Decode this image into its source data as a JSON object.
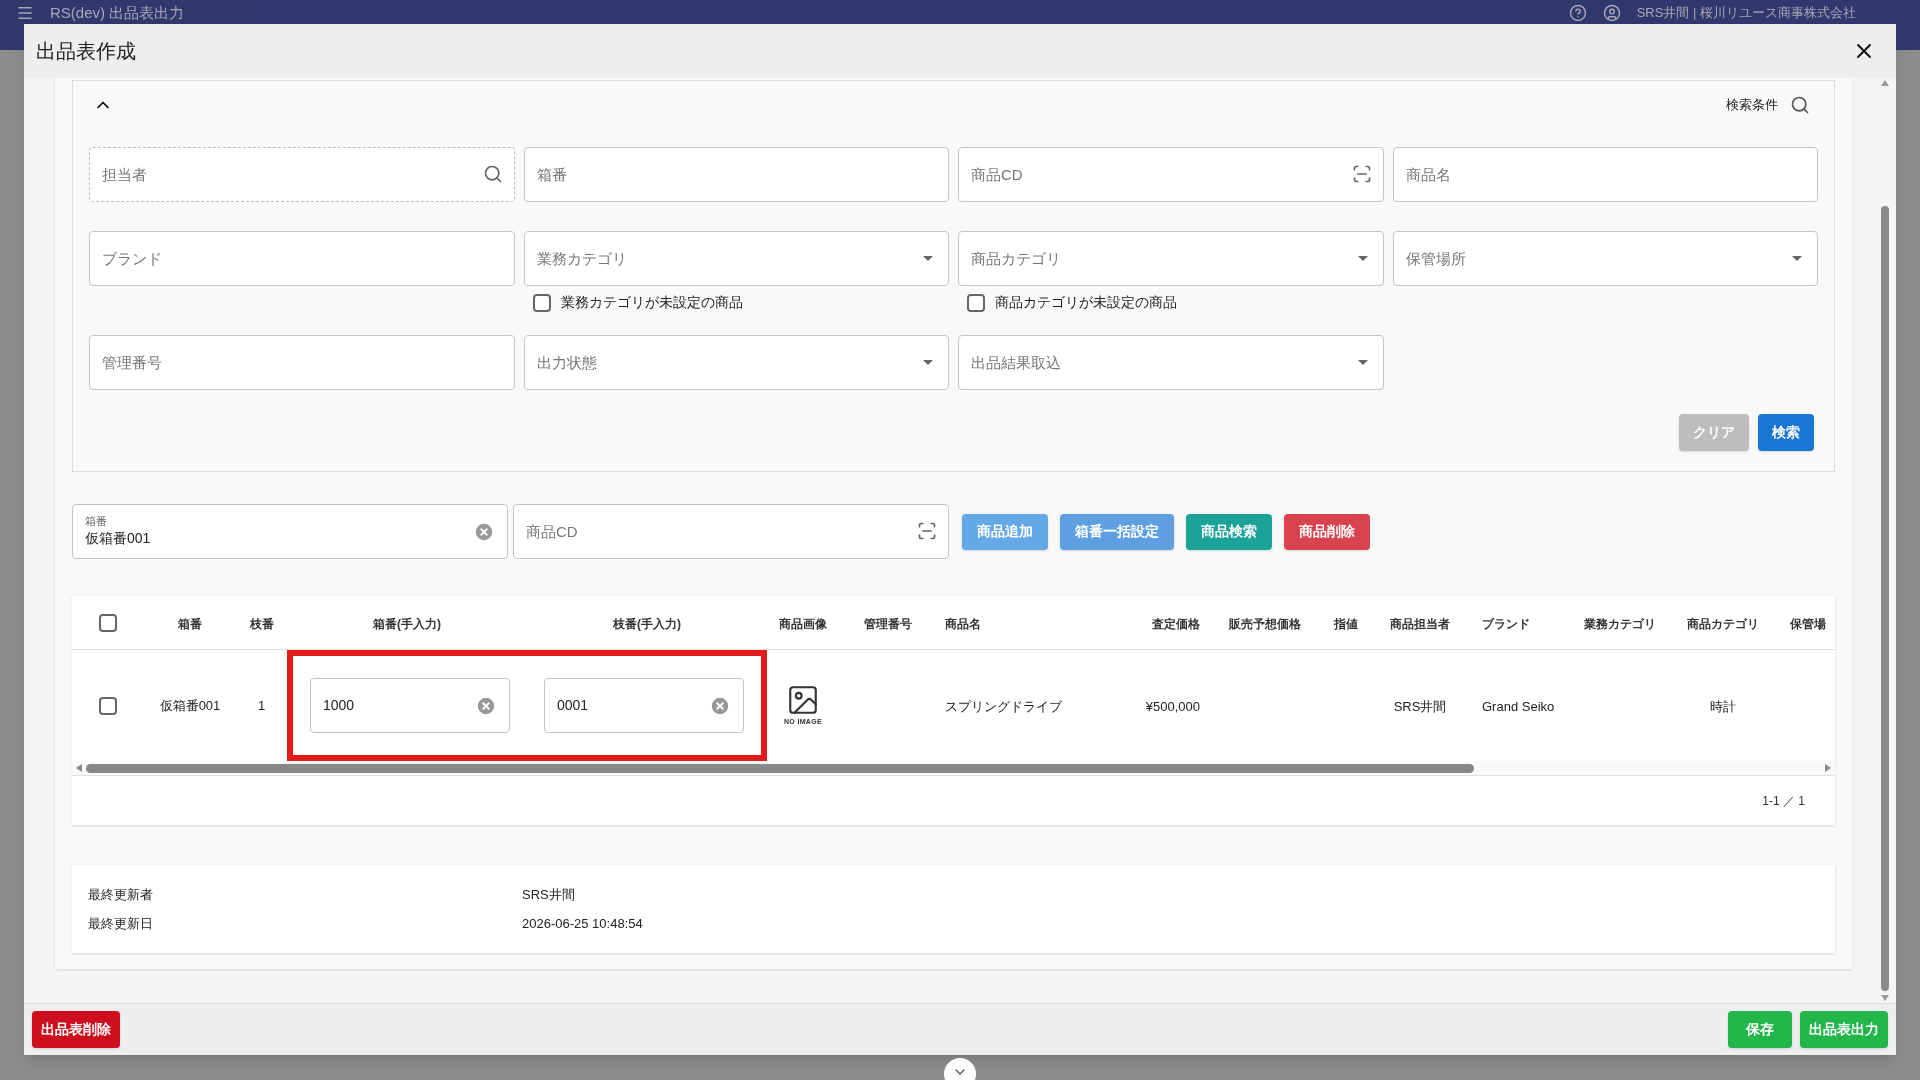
{
  "app_bar": {
    "title": "RS(dev) 出品表出力",
    "user": "SRS井間 | 桜川リユース商事株式会社"
  },
  "dialog": {
    "title": "出品表作成"
  },
  "search_panel": {
    "expanded": true,
    "label": "検索条件",
    "rows": [
      [
        {
          "kind": "search",
          "placeholder": "担当者"
        },
        {
          "kind": "text",
          "placeholder": "箱番"
        },
        {
          "kind": "scan",
          "placeholder": "商品CD"
        },
        {
          "kind": "text",
          "placeholder": "商品名"
        }
      ],
      [
        {
          "kind": "text",
          "placeholder": "ブランド"
        },
        {
          "kind": "select",
          "placeholder": "業務カテゴリ",
          "checkbox": {
            "label": "業務カテゴリが未設定の商品",
            "checked": false
          }
        },
        {
          "kind": "select",
          "placeholder": "商品カテゴリ",
          "checkbox": {
            "label": "商品カテゴリが未設定の商品",
            "checked": false
          }
        },
        {
          "kind": "select",
          "placeholder": "保管場所"
        }
      ],
      [
        {
          "kind": "text",
          "placeholder": "管理番号"
        },
        {
          "kind": "select",
          "placeholder": "出力状態"
        },
        {
          "kind": "select",
          "placeholder": "出品結果取込"
        }
      ]
    ],
    "buttons": [
      {
        "kind": "clear",
        "label": "クリア"
      },
      {
        "kind": "primary",
        "label": "検索"
      }
    ]
  },
  "entry": {
    "box_field": {
      "label": "箱番",
      "value": "仮箱番001"
    },
    "code_field": {
      "placeholder": "商品CD"
    },
    "buttons": [
      {
        "label": "商品追加",
        "color": "#64a8e6"
      },
      {
        "label": "箱番一括設定",
        "color": "#5d9fe0"
      },
      {
        "label": "商品検索",
        "color": "#1ba39a"
      },
      {
        "label": "商品削除",
        "color": "#d8434f"
      }
    ]
  },
  "table": {
    "columns": [
      "箱番",
      "枝番",
      "箱番(手入力)",
      "枝番(手入力)",
      "商品画像",
      "管理番号",
      "商品名",
      "査定価格",
      "販売予想価格",
      "指値",
      "商品担当者",
      "ブランド",
      "業務カテゴリ",
      "商品カテゴリ",
      "保管場"
    ],
    "all_checked": false,
    "rows": [
      {
        "checked": false,
        "highlighted": true,
        "no_image": "NO IMAGE",
        "cells": [
          "仮箱番001",
          "1",
          "1000",
          "0001",
          "",
          "",
          "スプリングドライブ",
          "¥500,000",
          "",
          "",
          "SRS井間",
          "Grand Seiko",
          "",
          "時計",
          ""
        ]
      }
    ],
    "pagination": "1-1 ／ 1"
  },
  "meta": [
    {
      "label": "最終更新者",
      "value": "SRS井間"
    },
    {
      "label": "最終更新日",
      "value": "2026-06-25 10:48:54"
    }
  ],
  "footer": {
    "delete": "出品表削除",
    "save": "保存",
    "export": "出品表出力"
  }
}
